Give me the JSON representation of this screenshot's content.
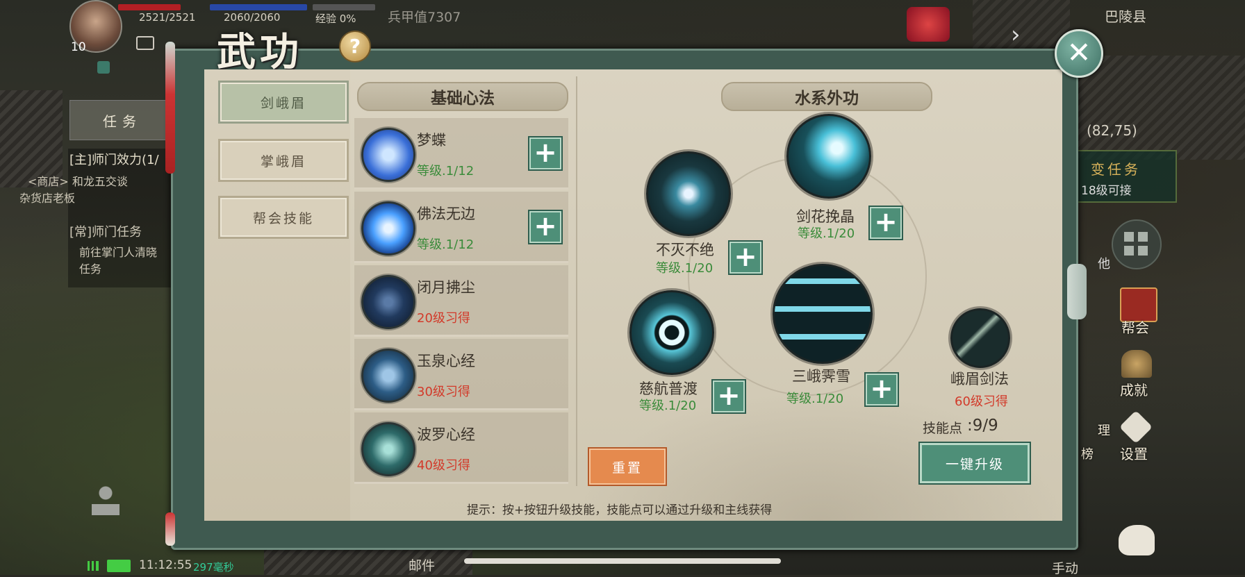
{
  "hud": {
    "level": "10",
    "hp": "2521/2521",
    "mp": "2060/2060",
    "exp": "经验 0%",
    "armor": "兵甲值7307",
    "location": "巴陵县",
    "coords": "(82,75)",
    "time": "11:12:55",
    "ping": "297毫秒",
    "mail": "邮件",
    "manual": "手动"
  },
  "left_quests": {
    "tab": "任务",
    "q1_title": "[主]师门效力(1/",
    "q1_line1": "<商店> 和龙五交谈",
    "q1_line2": "杂货店老板",
    "q2_title": "[常]师门任务",
    "q2_line1": "前往掌门人清晓",
    "q2_line2": "任务"
  },
  "right_menu": {
    "quest_banner": "变任务",
    "quest_sub": "18级可接",
    "guild": "帮会",
    "achievement": "成就",
    "settings": "设置",
    "rank_a": "理",
    "rank_b": "榜",
    "side_tab": "他"
  },
  "panel": {
    "title": "武功",
    "help": "?",
    "tabs": [
      "剑峨眉",
      "掌峨眉",
      "帮会技能"
    ],
    "basic_header": "基础心法",
    "outer_header": "水系外功",
    "reset": "重置",
    "upgrade_all": "一键升级",
    "skill_points_label": "技能点",
    "skill_points": ":9/9",
    "hint": "提示：按+按钮升级技能，技能点可以通过升级和主线获得"
  },
  "basic_skills": [
    {
      "name": "梦蝶",
      "status": "等级.1/12",
      "learned": true,
      "icon": "butterfly-icon"
    },
    {
      "name": "佛法无边",
      "status": "等级.1/12",
      "learned": true,
      "icon": "lotus-flame-icon"
    },
    {
      "name": "闭月拂尘",
      "status": "20级习得",
      "learned": false,
      "icon": "whisk-icon"
    },
    {
      "name": "玉泉心经",
      "status": "30级习得",
      "learned": false,
      "icon": "flower-icon"
    },
    {
      "name": "波罗心经",
      "status": "40级习得",
      "learned": false,
      "icon": "mandala-icon"
    }
  ],
  "outer_skills": {
    "buhuo": {
      "name": "不灭不绝",
      "status": "等级.1/20"
    },
    "jianhua": {
      "name": "剑花挽晶",
      "status": "等级.1/20"
    },
    "cihang": {
      "name": "慈航普渡",
      "status": "等级.1/20"
    },
    "sane": {
      "name": "三峨霁雪",
      "status": "等级.1/20"
    },
    "emei": {
      "name": "峨眉剑法",
      "status": "60级习得"
    }
  },
  "colors": {
    "level_green": "#3a8b3a",
    "locked_red": "#d23a2a",
    "plus_button": "#4e8f78",
    "reset_orange": "#e58a4e",
    "frame_teal": "#3f5a50"
  }
}
